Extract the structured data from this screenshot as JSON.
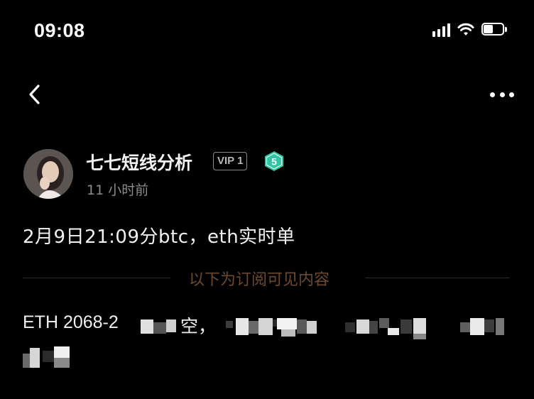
{
  "status_bar": {
    "time": "09:08",
    "icons": [
      "cellular-signal-icon",
      "wifi-icon",
      "battery-icon"
    ],
    "battery_level": 0.5
  },
  "nav": {
    "back_icon": "chevron-left-icon",
    "more_icon": "more-horizontal-icon"
  },
  "author": {
    "name": "七七短线分析",
    "vip_label": "VIP 1",
    "level": "5",
    "time_ago": "11 小时前"
  },
  "post": {
    "title": "2月9日21:09分btc，eth实时单",
    "divider_label": "以下为订阅可见内容",
    "content_visible_start": "ETH 2068-2",
    "content_visible_mid": "空，"
  },
  "colors": {
    "background": "#000000",
    "level_badge": "#35c4a3",
    "divider_label": "#6b4a2e",
    "secondary_text": "#8c8c8c"
  }
}
